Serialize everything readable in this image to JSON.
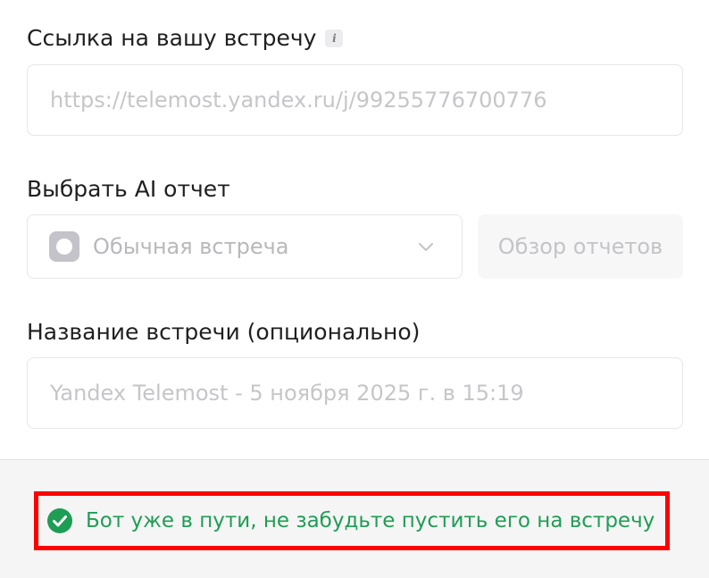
{
  "meeting_link": {
    "label": "Ссылка на вашу встречу",
    "info_icon_glyph": "i",
    "placeholder": "https://telemost.yandex.ru/j/99255776700776",
    "value": ""
  },
  "ai_report": {
    "label": "Выбрать AI отчет",
    "selected": "Обычная встреча",
    "reports_button_label": "Обзор отчетов"
  },
  "meeting_name": {
    "label": "Название встречи (опционально)",
    "placeholder": "Yandex Telemost - 5 ноября 2025 г. в 15:19",
    "value": ""
  },
  "status": {
    "message": "Бот уже в пути, не забудьте пустить его на встречу",
    "icon": "check-circle-icon"
  },
  "colors": {
    "success": "#1f9d55",
    "highlight": "#ff0000",
    "placeholder": "#c4c4c8",
    "footer_bg": "#f5f5f5"
  }
}
